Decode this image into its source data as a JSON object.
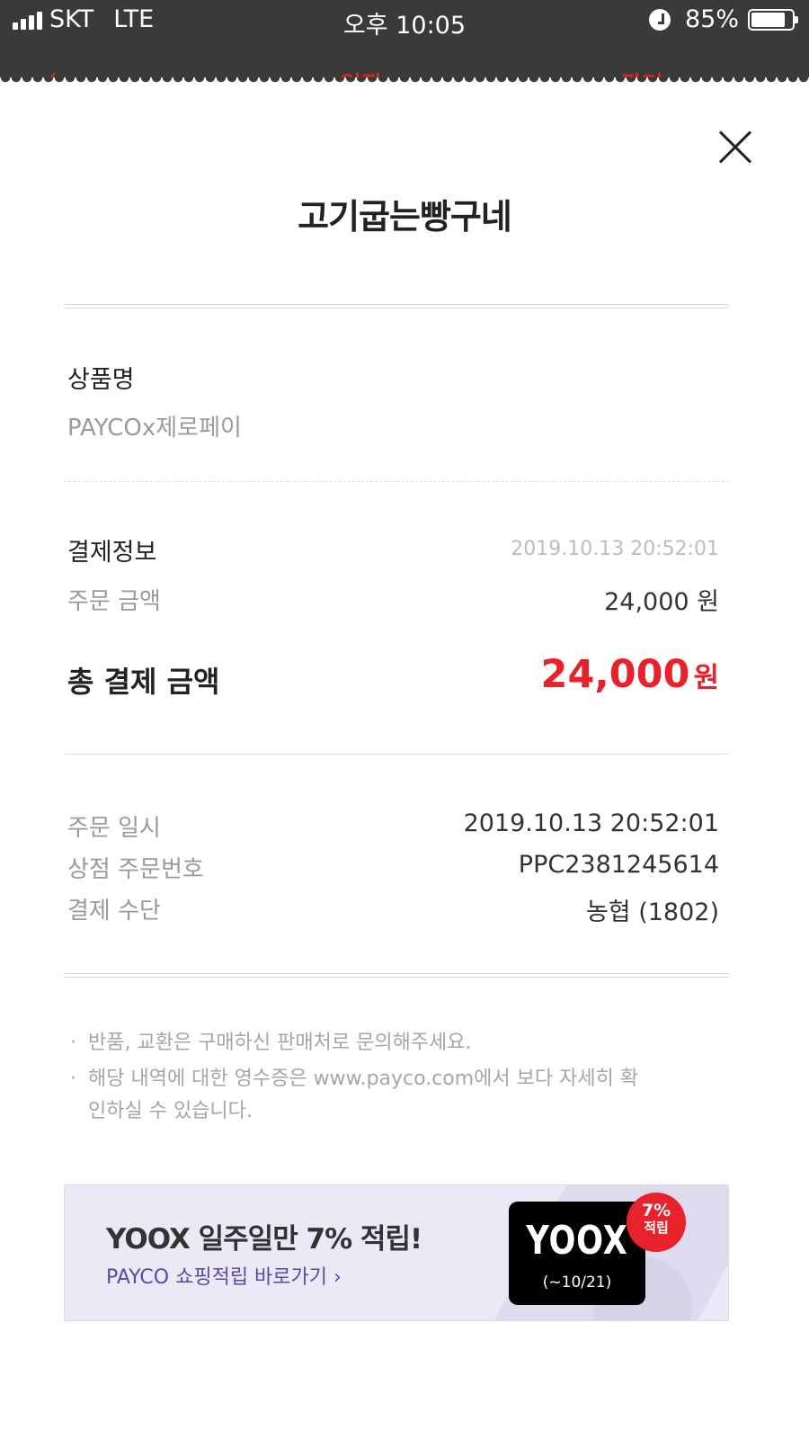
{
  "status_bar": {
    "carrier": "SKT",
    "network": "LTE",
    "time": "오후 10:05",
    "battery": "85%",
    "battery_level": 0.85
  },
  "background_app": {
    "hint1": "✓",
    "hint2": "입장",
    "hint3": "관리"
  },
  "receipt": {
    "store_name": "고기굽는빵구네",
    "product_label": "상품명",
    "product_value": "PAYCOx제로페이",
    "payment_info_label": "결제정보",
    "payment_info_datetime": "2019.10.13 20:52:01",
    "order_amount_label": "주문 금액",
    "order_amount_value": "24,000 원",
    "total_label": "총 결제 금액",
    "total_value": "24,000",
    "total_unit": "원",
    "details": [
      {
        "label": "주문 일시",
        "value": "2019.10.13 20:52:01"
      },
      {
        "label": "상점 주문번호",
        "value": "PPC2381245614"
      },
      {
        "label": "결제 수단",
        "value": "농협 (1802)"
      }
    ],
    "notes": {
      "note1": "반품, 교환은 구매하신 판매처로 문의해주세요.",
      "note2_line1": "해당 내역에 대한 영수증은 www.payco.com에서 보다 자세히 확",
      "note2_line2": "인하실 수 있습니다.",
      "bullet": "·"
    }
  },
  "banner": {
    "headline": "YOOX 일주일만 7% 적립!",
    "link": "PAYCO 쇼핑적립 바로가기 ›",
    "logo_text": "YOOX",
    "logo_period": "(~10/21)",
    "badge_percent": "7%",
    "badge_text": "적립",
    "colors": {
      "badge": "#e8222a",
      "background": "#ece8f6",
      "link": "#5a4aa0"
    }
  },
  "colors": {
    "status_bar": "#3a3a3a",
    "accent_red": "#e8222a"
  }
}
